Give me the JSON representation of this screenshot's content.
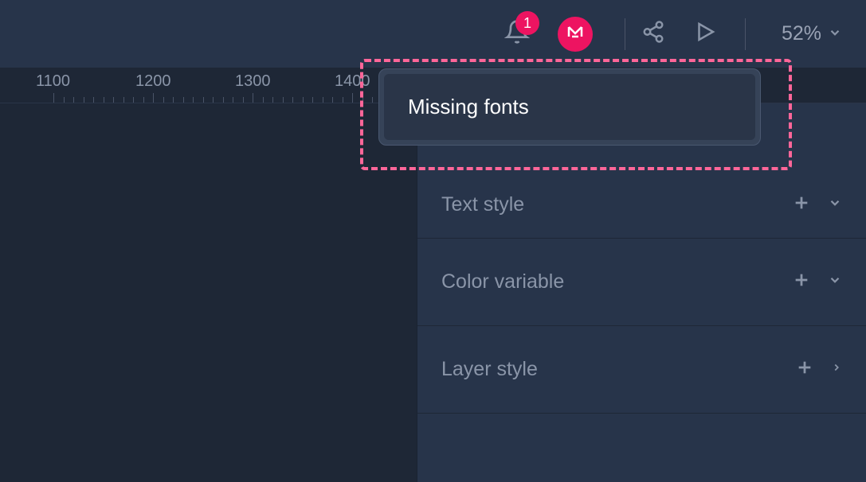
{
  "toolbar": {
    "notification_count": "1",
    "zoom_label": "52%"
  },
  "ruler": {
    "labels": [
      {
        "value": "1100",
        "pos": 45
      },
      {
        "value": "1200",
        "pos": 170
      },
      {
        "value": "1300",
        "pos": 295
      },
      {
        "value": "1400",
        "pos": 420
      }
    ]
  },
  "popup": {
    "item_label": "Missing fonts"
  },
  "panel": {
    "rows": [
      {
        "label": "Text style",
        "expand_icon": "chevron-down"
      },
      {
        "label": "Color variable",
        "expand_icon": "chevron-down"
      },
      {
        "label": "Layer style",
        "expand_icon": "chevron-right"
      }
    ]
  }
}
